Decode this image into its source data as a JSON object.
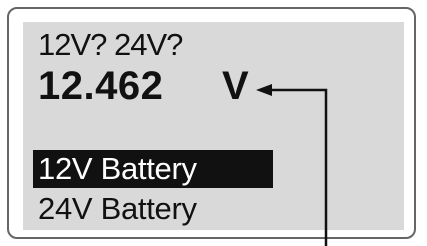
{
  "display": {
    "prompt": "12V? 24V?",
    "measurement": {
      "value": "12.462",
      "unit": "V"
    },
    "menu": {
      "items": [
        {
          "label": "12V Battery",
          "selected": true
        },
        {
          "label": "24V Battery",
          "selected": false
        }
      ]
    }
  },
  "colors": {
    "screen_background": "#d9d9d9",
    "text": "#111111",
    "selection_background": "#111111",
    "selection_text": "#ffffff",
    "frame": "#666666"
  },
  "icons": {
    "callout": "callout-arrow-icon"
  }
}
